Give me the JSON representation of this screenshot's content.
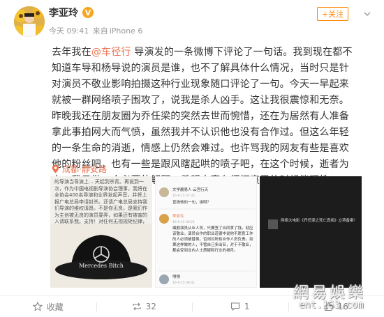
{
  "post": {
    "author": "李亚玲",
    "verified_badge": "V",
    "date": "今天 09:41",
    "source_prefix": "来自",
    "source": "iPhone 6",
    "follow_label": "+关注",
    "text_parts": {
      "p1": "去年我在",
      "mention": "@车径行",
      "p2": " 导演发的一条微博下评论了一句话。我到现在都不知道车导和杨导说的演员是谁，也不了解具体什么情况，当时只是针对演员不敬业影响拍摄这种行业现象随口评论了一句。今天一早起来就被一群网络喷子围攻了，说我是杀人凶手。这让我很震惊和无奈。昨晚我还在朋友圈为乔任梁的突然去世而惋惜，还在为居然有人准备拿此事拍网大而气愤，虽然我并不认识他也没有合作过。但这么年轻的一条生命的消逝，情感上仍然会难过。也许骂我的网友有些是喜欢他的粉丝吧，也有一些是跟风瞎起哄的喷子吧，在这个时候，逝者为大，我只做一个必要的解释，希望大家在缅怀哀思的时候能理性一点。逝者安息"
    },
    "location": "成都·静安路",
    "images": {
      "img1_text": "的导演当导演上... 天起到杀青。再说到一次，作为中国电视剧导演协会理事，我将在全协会400名导演和业界发起声音，并将上报广电总局申请封杀。还请广电总局支持我们导演的维权请愿。不是你无良，是我们作为主创被无良的演员耍弄，如果还有被害的人请联系我。支持！对任何无视规矩纪律，影响艺术生产和创作的行为绝不姑息！",
      "hat_text": "Mercedes Bitch",
      "comment1_user": "文学屠易人·云宫行天",
      "comment1_time": "16-9-15 07:35",
      "comment1_text": "宣扬他的一句，谁呀？",
      "comment2_user": "李亚玲",
      "comment2_time": "16-9-15 08:21",
      "comment2_text": "编剧演员从业人员，只要签了合同拿了钱，就应该敬业。演员合作的职业道德中说他不愿意工作的人必须被替换，否则对所有合作人员负责。如果这样做的人，不管自己多出名，对于不敬业，都会受到业内人士质疑和行业的排斥。",
      "comment3_user": "嘿嘿",
      "comment3_time": "16-9-15 08:41",
      "dark_text": "网络大电影《乔任梁之死亡真相》立项备案！"
    },
    "watermark": {
      "line1": "網易娛樂",
      "line2": "ent.163.com"
    },
    "actions": {
      "favorite": "收藏",
      "repost_count": "32",
      "comment_count": "1",
      "like_count": "16"
    }
  },
  "colors": {
    "accent": "#eb7350",
    "follow": "#ff8200",
    "badge": "#f5a623"
  }
}
